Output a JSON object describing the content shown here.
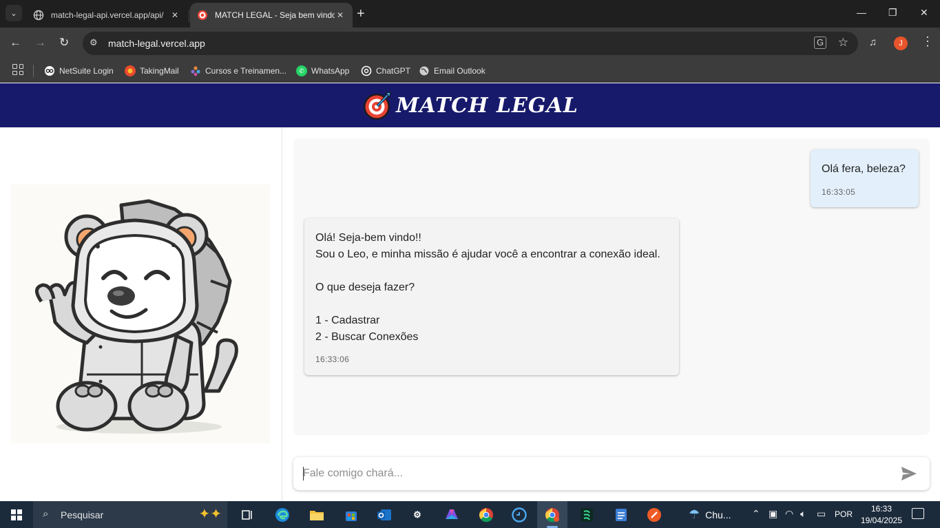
{
  "browser": {
    "tabs": [
      {
        "title": "match-legal-api.vercel.app/api/",
        "active": false
      },
      {
        "title": "MATCH LEGAL - Seja bem vindo",
        "active": true
      }
    ],
    "url": "match-legal.vercel.app",
    "profile_initial": "J",
    "bookmarks": [
      {
        "label": "NetSuite Login",
        "icon": "netsuite-icon",
        "color": "#ffffff"
      },
      {
        "label": "TakingMail",
        "icon": "takingmail-icon",
        "color": "#e94b2f"
      },
      {
        "label": "Cursos e Treinamen...",
        "icon": "courses-icon",
        "color": "#8a6fd1"
      },
      {
        "label": "WhatsApp",
        "icon": "whatsapp-icon",
        "color": "#25d366"
      },
      {
        "label": "ChatGPT",
        "icon": "chatgpt-icon",
        "color": "#ffffff"
      },
      {
        "label": "Email Outlook",
        "icon": "globe-icon",
        "color": "#cfcfcf"
      }
    ]
  },
  "app": {
    "brand_name": "MATCH LEGAL",
    "header_color": "#171a6b",
    "mascot": "robot-lion-mascot"
  },
  "chat": {
    "messages": [
      {
        "from": "user",
        "text": "Olá fera, beleza?",
        "time": "16:33:05"
      },
      {
        "from": "bot",
        "text": "Olá! Seja-bem vindo!!\nSou o Leo, e minha missão é ajudar você a encontrar a conexão ideal.\n\nO que deseja fazer?\n\n1 - Cadastrar\n2 - Buscar Conexões",
        "time": "16:33:06"
      }
    ],
    "input_placeholder": "Fale comigo chará..."
  },
  "taskbar": {
    "search_placeholder": "Pesquisar",
    "weather_text": "Chu...",
    "language": "POR",
    "time": "16:33",
    "date": "19/04/2025"
  }
}
